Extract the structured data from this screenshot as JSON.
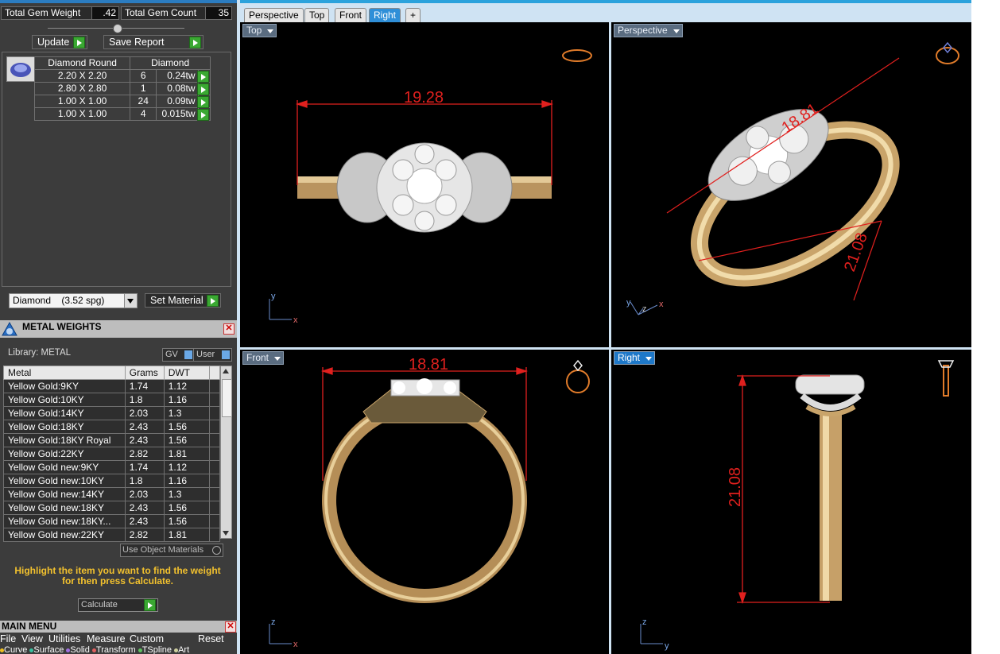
{
  "gem_summary": {
    "total_weight_label": "Total Gem Weight",
    "total_weight_value": ".42",
    "total_count_label": "Total Gem Count",
    "total_count_value": "35"
  },
  "actions": {
    "update_label": "Update",
    "save_report_label": "Save Report"
  },
  "gem_table": {
    "headers": [
      "Diamond Round",
      "Diamond"
    ],
    "rows": [
      {
        "size": "2.20 X 2.20",
        "count": "6",
        "weight": "0.24tw"
      },
      {
        "size": "2.80 X 2.80",
        "count": "1",
        "weight": "0.08tw"
      },
      {
        "size": "1.00 X 1.00",
        "count": "24",
        "weight": "0.09tw"
      },
      {
        "size": "1.00 X 1.00",
        "count": "4",
        "weight": "0.015tw"
      }
    ]
  },
  "material": {
    "selected": "Diamond    (3.52 spg)",
    "set_label": "Set Material"
  },
  "metal_panel": {
    "title": "METAL WEIGHTS",
    "library_label": "Library: METAL",
    "gv_label": "GV",
    "user_label": "User",
    "columns": [
      "Metal",
      "Grams",
      "DWT"
    ],
    "rows": [
      {
        "metal": "Yellow Gold:9KY",
        "grams": "1.74",
        "dwt": "1.12"
      },
      {
        "metal": "Yellow Gold:10KY",
        "grams": "1.8",
        "dwt": "1.16"
      },
      {
        "metal": "Yellow Gold:14KY",
        "grams": "2.03",
        "dwt": "1.3"
      },
      {
        "metal": "Yellow Gold:18KY",
        "grams": "2.43",
        "dwt": "1.56"
      },
      {
        "metal": "Yellow Gold:18KY Royal",
        "grams": "2.43",
        "dwt": "1.56"
      },
      {
        "metal": "Yellow Gold:22KY",
        "grams": "2.82",
        "dwt": "1.81"
      },
      {
        "metal": "Yellow Gold new:9KY",
        "grams": "1.74",
        "dwt": "1.12"
      },
      {
        "metal": "Yellow Gold new:10KY",
        "grams": "1.8",
        "dwt": "1.16"
      },
      {
        "metal": "Yellow Gold new:14KY",
        "grams": "2.03",
        "dwt": "1.3"
      },
      {
        "metal": "Yellow Gold new:18KY",
        "grams": "2.43",
        "dwt": "1.56"
      },
      {
        "metal": "Yellow Gold new:18KY...",
        "grams": "2.43",
        "dwt": "1.56"
      },
      {
        "metal": "Yellow Gold new:22KY",
        "grams": "2.82",
        "dwt": "1.81"
      }
    ],
    "use_object_materials": "Use Object Materials",
    "hint": "Highlight the item you want to find the weight for then press Calculate.",
    "calculate_label": "Calculate"
  },
  "main_menu": {
    "title": "MAIN MENU",
    "items": [
      "File",
      "View",
      "Utilities",
      "Measure",
      "Custom"
    ],
    "reset": "Reset",
    "toolbar": [
      "Curve",
      "Surface",
      "Solid",
      "Transform",
      "TSpline",
      "Art"
    ]
  },
  "tabs": [
    "Perspective",
    "Top",
    "Front",
    "Right"
  ],
  "tab_add": "+",
  "viewports": {
    "top": {
      "name": "Top",
      "dimension": "19.28",
      "axis1": "y",
      "axis2": "x"
    },
    "perspective": {
      "name": "Perspective",
      "dimension1": "18.81",
      "dimension2": "21.08",
      "axis1": "y",
      "axis2": "z",
      "axis3": "x"
    },
    "front": {
      "name": "Front",
      "dimension": "18.81",
      "axis1": "z",
      "axis2": "x"
    },
    "right": {
      "name": "Right",
      "dimension": "21.08",
      "axis1": "z",
      "axis2": "y"
    }
  },
  "colors": {
    "accent": "#2f8fd8",
    "dimension": "#e0201e",
    "gold": "#c9a46a",
    "panel": "#3c3c3c",
    "hint": "#f2c12e"
  }
}
